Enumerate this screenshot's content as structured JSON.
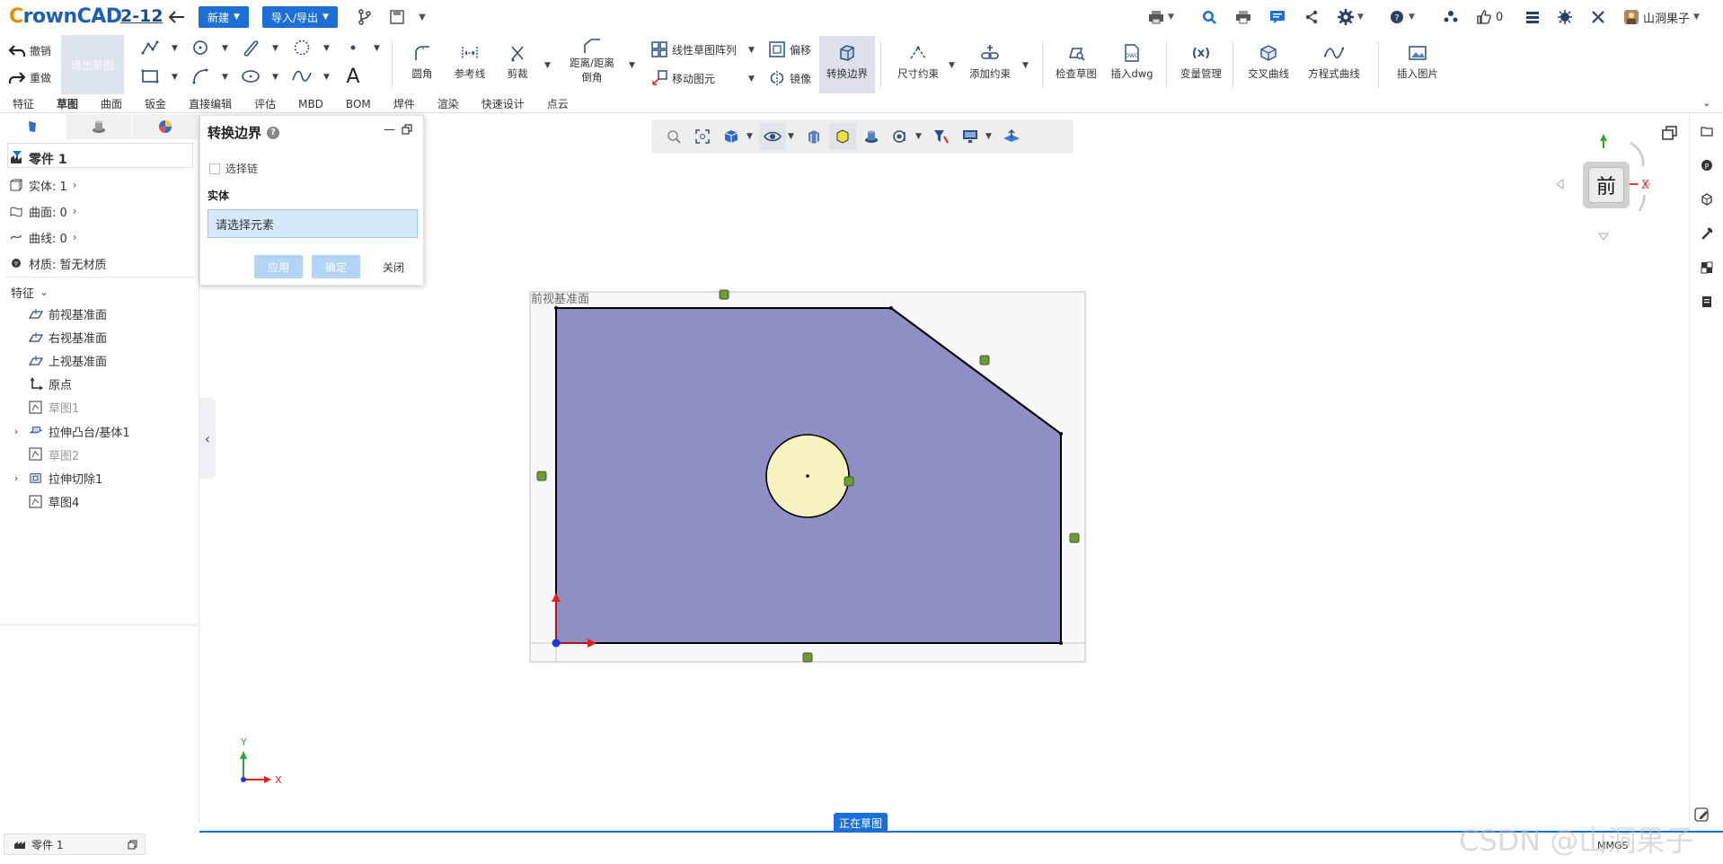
{
  "app": {
    "logo_prefix": "C",
    "logo_rest": "rownCAD",
    "doc_name": "2-12",
    "new_label": "新建",
    "import_export_label": "导入/导出",
    "likes": "0",
    "user": "山洞果子"
  },
  "ribbon": {
    "undo": "撤销",
    "redo": "重做",
    "exit_sketch": "退出草图",
    "fillet": "圆角",
    "ref_line": "参考线",
    "trim": "剪裁",
    "dist_chamfer_1": "距离/距离",
    "dist_chamfer_2": "倒角",
    "linear_pattern": "线性草图阵列",
    "offset": "偏移",
    "move_entity": "移动图元",
    "mirror": "镜像",
    "convert_entities": "转换边界",
    "dim_constraint": "尺寸约束",
    "add_constraint": "添加约束",
    "check_sketch": "检查草图",
    "insert_dwg": "插入dwg",
    "variables_icon": "(x)",
    "variables": "变量管理",
    "intersect_curve": "交叉曲线",
    "equation_curve": "方程式曲线",
    "insert_image": "插入图片"
  },
  "tabs": [
    "特征",
    "草图",
    "曲面",
    "钣金",
    "直接编辑",
    "评估",
    "MBD",
    "BOM",
    "焊件",
    "渲染",
    "快速设计",
    "点云"
  ],
  "active_tab": "草图",
  "tree": {
    "part_name": "零件 1",
    "solids": "实体: 1",
    "surfaces": "曲面: 0",
    "curves": "曲线: 0",
    "material": "材质:  暂无材质",
    "features_header": "特征",
    "items": [
      {
        "label": "前视基准面",
        "dim": false,
        "expand": false
      },
      {
        "label": "右视基准面",
        "dim": false,
        "expand": false
      },
      {
        "label": "上视基准面",
        "dim": false,
        "expand": false
      },
      {
        "label": "原点",
        "dim": false,
        "expand": false
      },
      {
        "label": "草图1",
        "dim": true,
        "expand": false
      },
      {
        "label": "拉伸凸台/基体1",
        "dim": false,
        "expand": true
      },
      {
        "label": "草图2",
        "dim": true,
        "expand": false
      },
      {
        "label": "拉伸切除1",
        "dim": false,
        "expand": true
      },
      {
        "label": "草图4",
        "dim": false,
        "expand": false
      }
    ]
  },
  "dialog": {
    "title": "转换边界",
    "help": "?",
    "select_chain": "选择链",
    "section": "实体",
    "placeholder": "请选择元素",
    "apply": "应用",
    "ok": "确定",
    "close": "关闭"
  },
  "canvas": {
    "plane_label": "前视基准面",
    "axis_x": "X",
    "axis_y": "Y",
    "view_label": "前",
    "fill_color": "#8f8fc6",
    "circle_color": "#f7f3c0"
  },
  "status": {
    "sketching": "正在草图",
    "bottom_tab": "零件 1",
    "units": "MMGS",
    "watermark": "CSDN @山洞果子"
  }
}
